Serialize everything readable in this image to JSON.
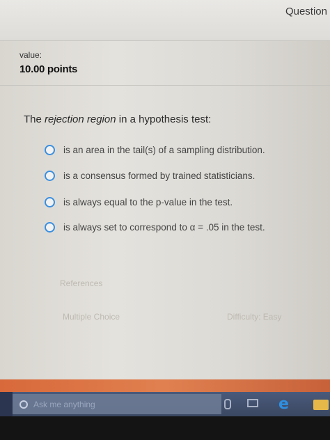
{
  "header": {
    "question_label": "Question"
  },
  "value": {
    "label": "value:",
    "points": "10.00 points"
  },
  "question": {
    "text_before": "The ",
    "text_emphasis": "rejection region",
    "text_after": " in a hypothesis test:"
  },
  "options": [
    {
      "label": "is an area in the tail(s) of a sampling distribution."
    },
    {
      "label": "is a consensus formed by trained statisticians."
    },
    {
      "label": "is always equal to the p-value in the test."
    },
    {
      "label": "is always set to correspond to α = .05 in the test."
    }
  ],
  "links": {
    "references": "References",
    "multiple_choice": "Multiple Choice",
    "difficulty": "Difficulty: Easy"
  },
  "taskbar": {
    "search_placeholder": "Ask me anything"
  },
  "colors": {
    "radio_border": "#3a8fe0",
    "taskbar": "#3b4863",
    "stripe": "#d8693a"
  }
}
